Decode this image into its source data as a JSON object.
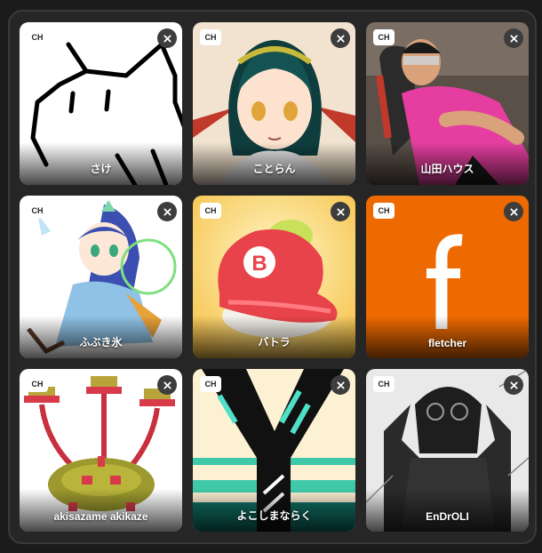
{
  "channels": [
    {
      "name": "さけ",
      "badge": "CH",
      "art": "cat-doodle"
    },
    {
      "name": "ことらん",
      "badge": "CH",
      "art": "anime-girl"
    },
    {
      "name": "山田ハウス",
      "badge": "CH",
      "art": "person-photo"
    },
    {
      "name": "ふぶき氷",
      "badge": "CH",
      "art": "anime-ice-girl"
    },
    {
      "name": "バトラ",
      "badge": "CH",
      "art": "sushi-cap"
    },
    {
      "name": "fletcher",
      "badge": "CH",
      "art": "letter-f"
    },
    {
      "name": "akisazame akikaze",
      "badge": "CH",
      "art": "pixel-creature"
    },
    {
      "name": "よこしまならく",
      "badge": "CH",
      "art": "letter-y"
    },
    {
      "name": "EnDrOLI",
      "badge": "CH",
      "art": "sketch-figure"
    }
  ],
  "icons": {
    "close": "close-icon"
  },
  "colors": {
    "panel": "#262626",
    "card_orange": "#ee6a00",
    "close_bg": "#3d3d3d"
  }
}
